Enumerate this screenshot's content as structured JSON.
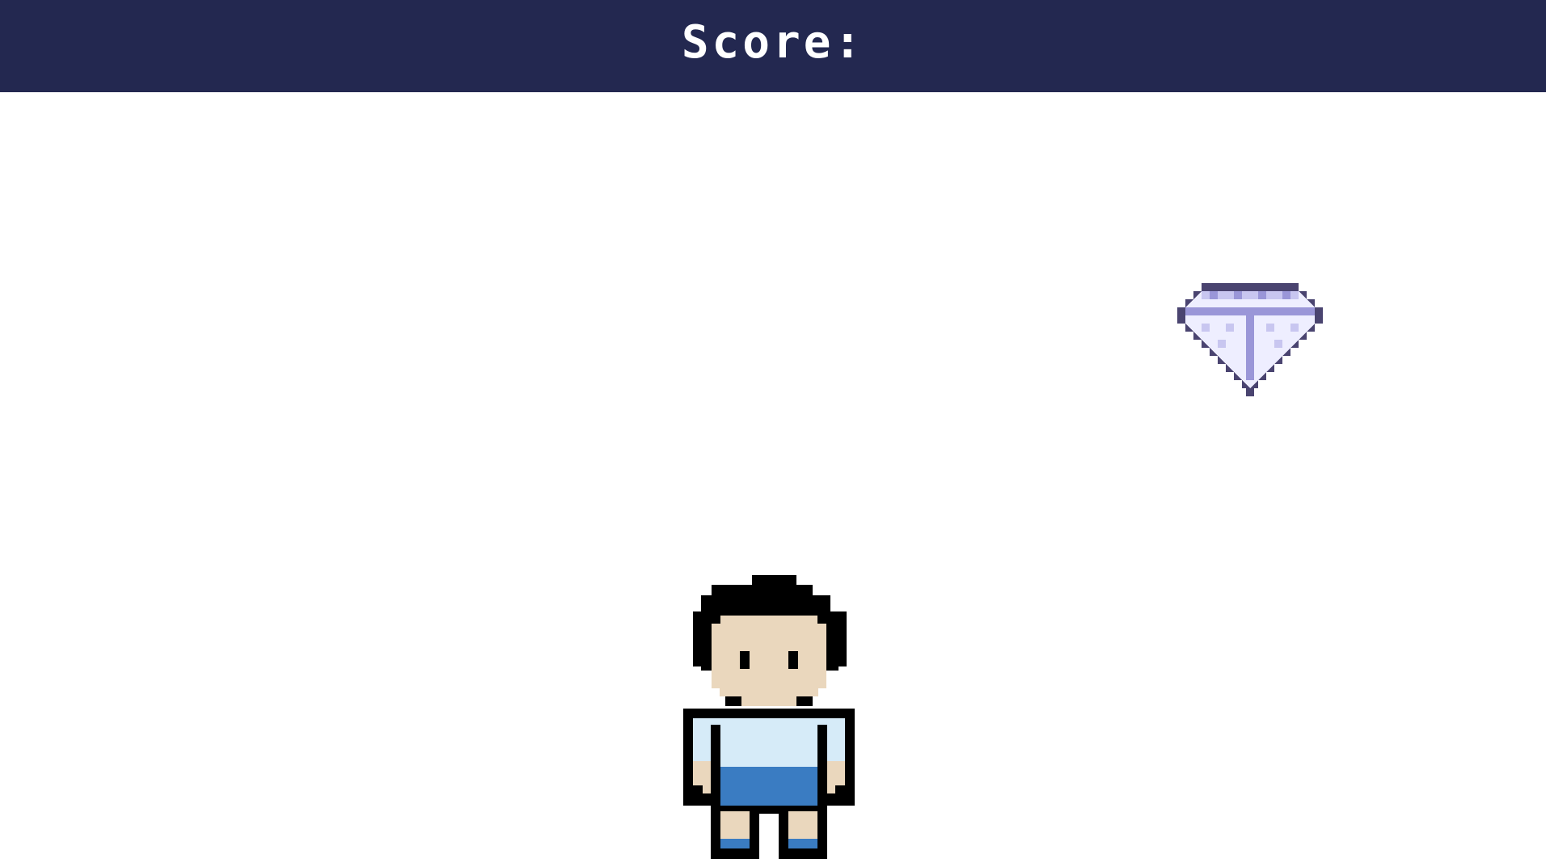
{
  "header": {
    "score_label": "Score:"
  },
  "colors": {
    "header_bg": "#232850",
    "gem_outline": "#4a4470",
    "gem_light": "#eeeeff",
    "gem_mid": "#c8c6f0",
    "gem_dark": "#9a96d8",
    "hair": "#000000",
    "skin": "#ead7bd",
    "shirt": "#d6ebf8",
    "shorts": "#3a7cc2"
  },
  "sprites": {
    "gem": "diamond-gem-icon",
    "player": "player-character"
  }
}
